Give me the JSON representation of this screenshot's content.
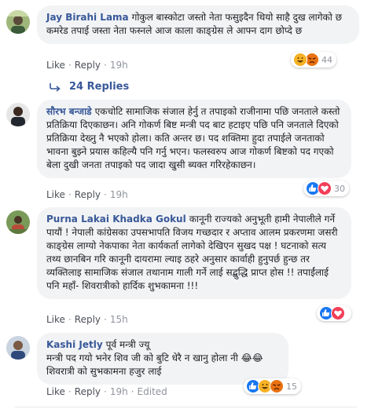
{
  "common": {
    "like": "Like",
    "reply": "Reply",
    "dot": "·"
  },
  "replies_link": {
    "label": "24 Replies"
  },
  "comments": [
    {
      "author": "Jay Birahi Lama",
      "text": "गोकुल बास्कोटा जस्तो नेता फसुइदैन थियो साहै दुख लागेको छ कमरेड तपाई जस्ता नेता फस्नले आज काला काङ्ग्रेस ले आफ्न दाग छोप्दे छ",
      "time": "19h",
      "reactions": [
        "haha",
        "angry"
      ],
      "reaction_count": "44"
    },
    {
      "author": "सौरभ बन्जाडे",
      "text": "एकचोटि सामाजिक संजाल हेर्नु त तपाइको राजीनामा पछि जनताले कस्तो प्रतिक्रिया दिएकाछन। अनि गोकर्ण बिष्ट मन्त्री पद बाट हटाइए पछि पनि जनताले दिएको प्रतिक्रिया देख्नु नै भएको होला। कति अन्तर छ। पद शक्तिमा हुदा तपाईले जनताको भावना बुझ्ने प्रयास कहिल्यै पनि गर्नु भएन। फलस्वरुप आज गोकर्ण बिष्टको पद गएको बेला दुखी जनता तपाइको पद जादा खुसी ब्यक्त गरिरहेकाछन।",
      "time": "19h",
      "reactions": [
        "like",
        "love"
      ],
      "reaction_count": "30"
    },
    {
      "author": "Purna Lakai Khadka Gokul",
      "text": "कानूनी राज्यको अनुभूती हामी नेपालीले गर्ने पायौं ! नेपाली कांग्रेसका उपसभापति विजय गच्छदार र अप्ताव आलम प्रकरणमा जसरी काङ्ग्रेस लाग्यो नेकपाका नेता कार्यकर्ता लागेको देखिएन सुखद पक्ष ! घटनाको सत्य तथ्य छानबिन गरि कानूनी दायरामा ल्याइ ठहरे अनुसार कार्वाही हुनुपर्छ हुन्छ तर व्यक्तिलाइ सामाजिक संजाल तथानाम गाली गर्ने लाई सद्बुद्धि प्राप्त होस !! तपाईंलाई पनि महाँ- शिवरात्रीको हार्दिक शुभकामना !!!",
      "time": "15h",
      "reactions": [
        "like",
        "love"
      ],
      "reaction_count": ""
    },
    {
      "author": "Kashi Jetly",
      "text": "पूर्व मन्त्री ज्यू\nमन्त्री पद गयो भनेर शिव जी को बुटि धेरै न खानु होला नी 😂😂\nशिवरात्री को सुभकामना हजुर लाई",
      "time": "19h",
      "edited": "Edited",
      "reactions": [
        "like",
        "haha",
        "angry"
      ],
      "reaction_count": "15"
    }
  ],
  "colors": {
    "name": "#385898",
    "bubble": "#f2f3f5",
    "meta": "#90949c",
    "like": "#1877f2",
    "love": "#f33e58",
    "haha": "#f7b125",
    "angry": "#e9710f"
  }
}
